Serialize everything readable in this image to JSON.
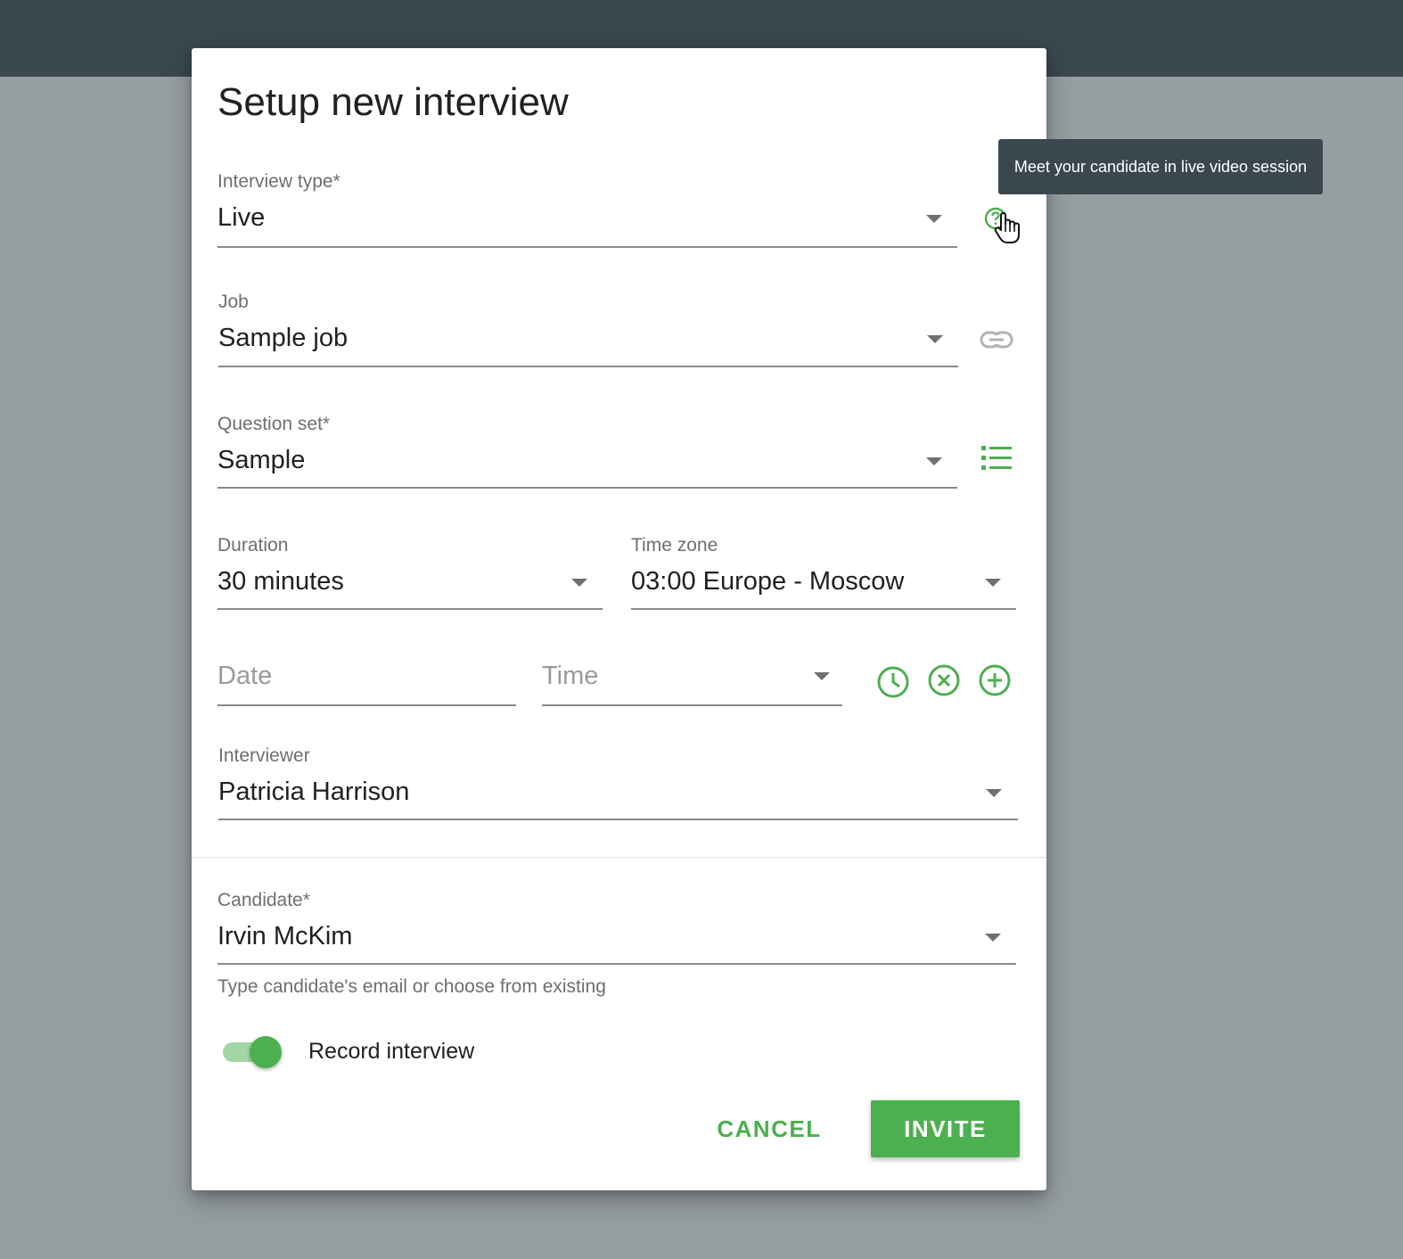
{
  "dialog": {
    "title": "Setup new interview"
  },
  "interview_type": {
    "label": "Interview type*",
    "value": "Live"
  },
  "tooltip": {
    "text": "Meet your candidate in live video session"
  },
  "job": {
    "label": "Job",
    "value": "Sample job"
  },
  "question_set": {
    "label": "Question set*",
    "value": "Sample"
  },
  "duration": {
    "label": "Duration",
    "value": "30 minutes"
  },
  "time_zone": {
    "label": "Time zone",
    "value": "03:00 Europe - Moscow"
  },
  "date": {
    "placeholder": "Date"
  },
  "time": {
    "placeholder": "Time"
  },
  "interviewer": {
    "label": "Interviewer",
    "value": "Patricia Harrison"
  },
  "candidate": {
    "label": "Candidate*",
    "value": "Irvin McKim",
    "helper": "Type candidate's email or choose from existing"
  },
  "record_interview": {
    "label": "Record interview",
    "enabled": true
  },
  "actions": {
    "cancel": "CANCEL",
    "invite": "INVITE"
  },
  "colors": {
    "accent": "#4caf50",
    "header": "#3a474f",
    "backdrop": "#969ea1",
    "tooltip_bg": "#3a474f"
  },
  "icons": {
    "help": "help-circle-icon",
    "link": "link-icon",
    "list": "list-icon",
    "clock": "clock-icon",
    "remove": "remove-circle-icon",
    "add": "add-circle-icon",
    "dropdown": "chevron-down-icon",
    "cursor": "hand-cursor-icon"
  }
}
